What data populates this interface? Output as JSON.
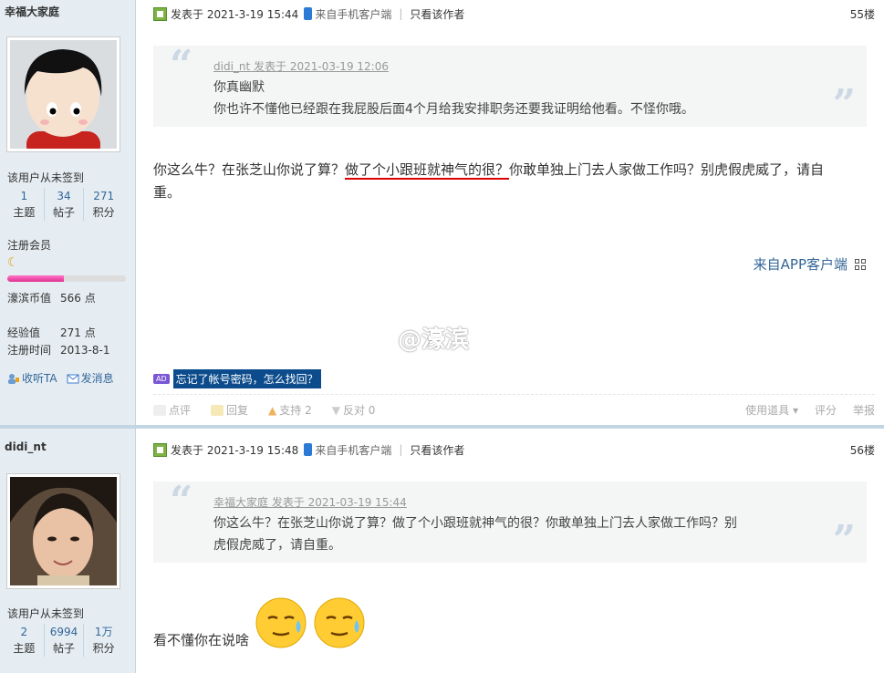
{
  "post1": {
    "user": {
      "name": "幸福大家庭",
      "signin": "该用户从未签到",
      "stats": [
        {
          "num": "1",
          "label": "主题"
        },
        {
          "num": "34",
          "label": "帖子"
        },
        {
          "num": "271",
          "label": "积分"
        }
      ],
      "group": "注册会员",
      "progress": 0.48,
      "wealth_label": "濠滨币值",
      "wealth_value": "566 点",
      "exp_label": "经验值",
      "exp_value": "271 点",
      "reg_label": "注册时间",
      "reg_value": "2013-8-1",
      "follow": "收听TA",
      "message": "发消息"
    },
    "meta": {
      "posted": "发表于 2021-3-19 15:44",
      "source": "来自手机客户端",
      "only_author": "只看该作者",
      "floor": "55楼"
    },
    "quote": {
      "head": "didi_nt 发表于 2021-03-19 12:06",
      "line1": "你真幽默",
      "line2": "你也许不懂他已经跟在我屁股后面4个月给我安排职务还要我证明给他看。不怪你哦。"
    },
    "body": {
      "part1": "你这么牛？在张芝山你说了算？",
      "highlight": "做了个小跟班就神气的很？",
      "part2": "你敢单独上门去人家做工作吗？别虎假虎威了，请自",
      "part3": "重。"
    },
    "app_source": "来自APP客户端",
    "watermark": "@濠滨",
    "ad": {
      "tag": "AD",
      "text": "忘记了帐号密码，怎么找回？"
    },
    "toolbar": {
      "comment": "点评",
      "reply": "回复",
      "support": "支持 2",
      "oppose": "反对 0",
      "tools": "使用道具",
      "rate": "评分",
      "report": "举报"
    }
  },
  "post2": {
    "user": {
      "name": "didi_nt",
      "signin": "该用户从未签到",
      "stats": [
        {
          "num": "2",
          "label": "主题"
        },
        {
          "num": "6994",
          "label": "帖子"
        },
        {
          "num": "1万",
          "label": "积分"
        }
      ]
    },
    "meta": {
      "posted": "发表于 2021-3-19 15:48",
      "source": "来自手机客户端",
      "only_author": "只看该作者",
      "floor": "56楼"
    },
    "quote": {
      "head": "幸福大家庭 发表于 2021-03-19 15:44",
      "line1": "你这么牛？在张芝山你说了算？做了个小跟班就神气的很？你敢单独上门去人家做工作吗？别",
      "line2": "虎假虎威了，请自重。"
    },
    "body": "看不懂你在说啥"
  },
  "colors": {
    "link": "#336699",
    "sidebar": "#e5edf2",
    "divider": "#c2d5e3",
    "highlight_underline": "#dd0000"
  }
}
